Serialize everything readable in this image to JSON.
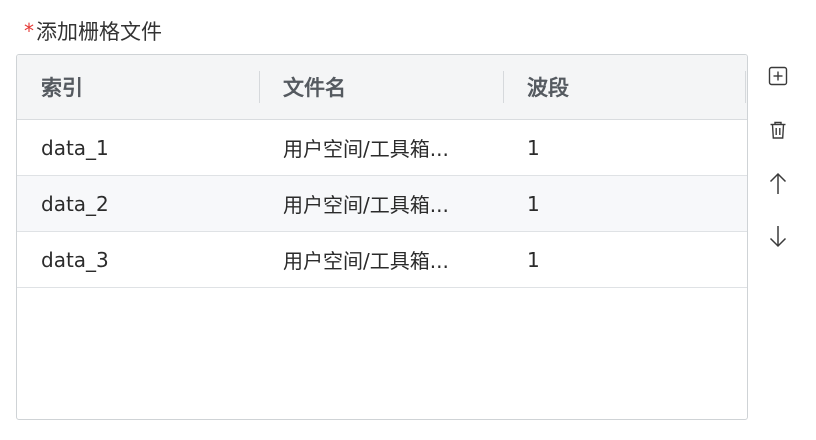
{
  "form": {
    "required_mark": "*",
    "label": "添加栅格文件"
  },
  "table": {
    "columns": [
      "索引",
      "文件名",
      "波段"
    ],
    "rows": [
      {
        "index": "data_1",
        "file": "用户空间/工具箱...",
        "band": "1"
      },
      {
        "index": "data_2",
        "file": "用户空间/工具箱...",
        "band": "1"
      },
      {
        "index": "data_3",
        "file": "用户空间/工具箱...",
        "band": "1"
      }
    ]
  },
  "tools": {
    "icons": [
      "add-icon",
      "delete-icon",
      "move-up-icon",
      "move-down-icon"
    ]
  }
}
